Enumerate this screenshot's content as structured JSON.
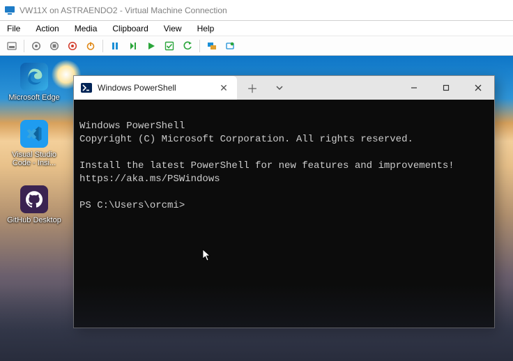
{
  "vm_window": {
    "title": "VW11X on ASTRAENDO2 - Virtual Machine Connection"
  },
  "menubar": {
    "file": "File",
    "action": "Action",
    "media": "Media",
    "clipboard": "Clipboard",
    "view": "View",
    "help": "Help"
  },
  "toolbar_icons": {
    "ctrl_alt_del": "ctrl-alt-del",
    "send_key": "send-key",
    "stop": "stop",
    "shutdown": "shutdown",
    "power": "power",
    "pause": "pause",
    "start": "start",
    "save": "save",
    "revert": "revert",
    "enhanced": "enhanced",
    "actions": "actions"
  },
  "desktop_icons": {
    "edge": "Microsoft Edge",
    "vscode": "Visual Studio Code - Insi...",
    "github": "GitHub Desktop"
  },
  "ps_window": {
    "tab_title": "Windows PowerShell",
    "terminal": {
      "line1": "Windows PowerShell",
      "line2": "Copyright (C) Microsoft Corporation. All rights reserved.",
      "line3": "",
      "line4": "Install the latest PowerShell for new features and improvements!",
      "line5": "https://aka.ms/PSWindows",
      "line6": "",
      "prompt": "PS C:\\Users\\orcmi>"
    }
  }
}
